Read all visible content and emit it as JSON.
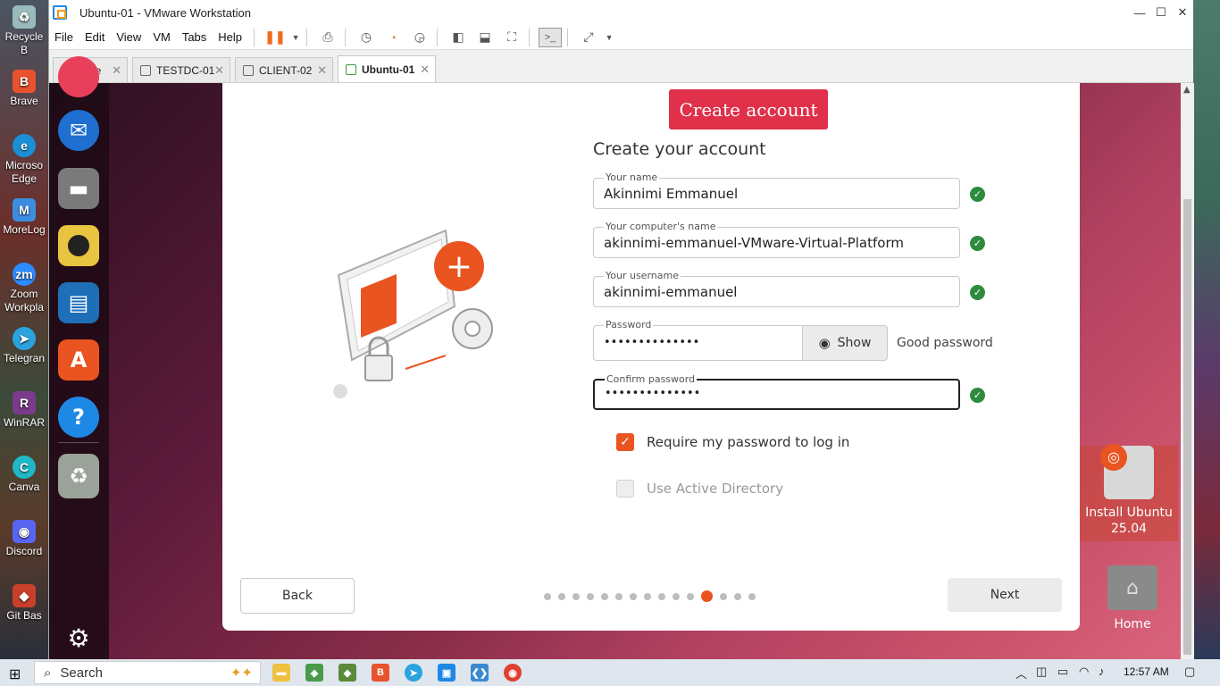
{
  "window": {
    "title": "Ubuntu-01 - VMware Workstation"
  },
  "menu": [
    "File",
    "Edit",
    "View",
    "VM",
    "Tabs",
    "Help"
  ],
  "tabs": [
    {
      "label": "Home",
      "active": false
    },
    {
      "label": "TESTDC-01",
      "active": false
    },
    {
      "label": "CLIENT-02",
      "active": false
    },
    {
      "label": "Ubuntu-01",
      "active": true
    }
  ],
  "desktop_icons": [
    "Recycle B",
    "Brave",
    "Microso Edge",
    "MoreLog",
    "Zoom Workpla",
    "Telegran",
    "WinRAR",
    "Canva",
    "Discord",
    "Git Bas"
  ],
  "installer": {
    "header_button": "Create account",
    "title": "Create your account",
    "fields": {
      "name": {
        "label": "Your name",
        "value": "Akinnimi Emmanuel"
      },
      "computer": {
        "label": "Your computer's name",
        "value": "akinnimi-emmanuel-VMware-Virtual-Platform"
      },
      "username": {
        "label": "Your username",
        "value": "akinnimi-emmanuel"
      },
      "password": {
        "label": "Password",
        "value": "••••••••••••••"
      },
      "confirm": {
        "label": "Confirm password",
        "value": "••••••••••••••"
      }
    },
    "show_label": "Show",
    "password_strength": "Good password",
    "require_password": {
      "label": "Require my password to log in",
      "checked": true
    },
    "active_directory": {
      "label": "Use Active Directory",
      "checked": false
    },
    "back_label": "Back",
    "next_label": "Next",
    "progress": {
      "current_step": 12,
      "total_steps": 15
    }
  },
  "guest_desktop": {
    "install_icon_label": "Install Ubuntu 25.04",
    "home_icon_label": "Home"
  },
  "taskbar": {
    "search_label": "Search",
    "time": "12:57 AM"
  },
  "colors": {
    "ubuntu_orange": "#e95420",
    "create_button": "#e0304a",
    "check_green": "#2e8b3e"
  }
}
